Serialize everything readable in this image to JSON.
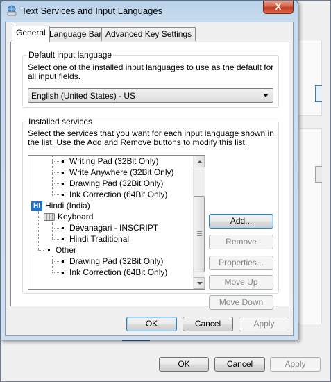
{
  "dialog": {
    "title": "Text Services and Input Languages",
    "close_glyph": "X"
  },
  "tabs": [
    {
      "label": "General"
    },
    {
      "label": "Language Bar"
    },
    {
      "label": "Advanced Key Settings"
    }
  ],
  "default_input": {
    "group_label": "Default input language",
    "description": "Select one of the installed input languages to use as the default for all input fields.",
    "selected": "English (United States) - US"
  },
  "installed": {
    "group_label": "Installed services",
    "description": "Select the services that you want for each input language shown in the list. Use the Add and Remove buttons to modify this list.",
    "tree": {
      "top_items": [
        "Writing Pad (32Bit Only)",
        "Write Anywhere (32Bit Only)",
        "Drawing Pad (32Bit Only)",
        "Ink Correction (64Bit Only)"
      ],
      "language_badge": "HI",
      "language": "Hindi (India)",
      "keyboard_label": "Keyboard",
      "keyboard_items": [
        "Devanagari - INSCRIPT",
        "Hindi Traditional"
      ],
      "other_label": "Other",
      "other_items": [
        "Drawing Pad (32Bit Only)",
        "Ink Correction (64Bit Only)"
      ]
    },
    "buttons": {
      "add": "Add...",
      "remove": "Remove",
      "properties": "Properties...",
      "move_up": "Move Up",
      "move_down": "Move Down"
    }
  },
  "footer": {
    "ok": "OK",
    "cancel": "Cancel",
    "apply": "Apply"
  },
  "bg_footer": {
    "ok": "OK",
    "cancel": "Cancel",
    "apply": "Apply"
  }
}
